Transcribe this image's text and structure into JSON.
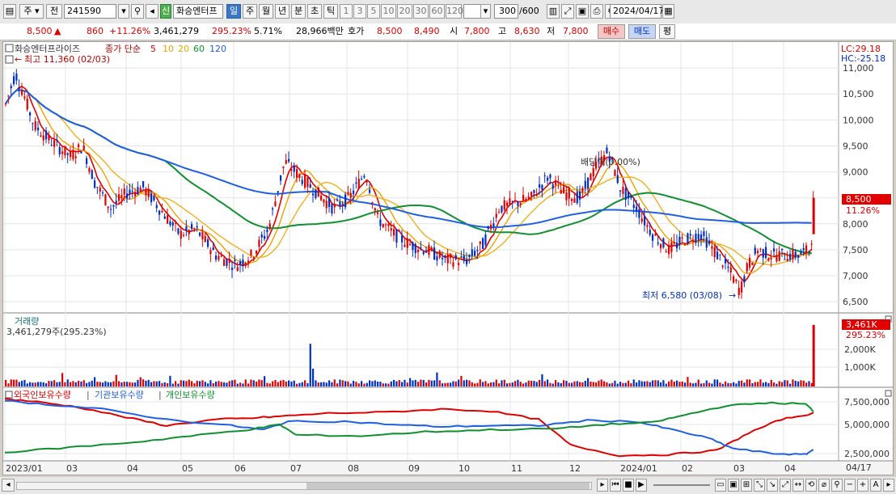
{
  "toolbar": {
    "market": "주",
    "type": "전",
    "code": "241590",
    "new_badge": "신",
    "stock_name": "화승엔터프",
    "periods": [
      "일",
      "주",
      "월",
      "년",
      "분",
      "초",
      "틱"
    ],
    "minute_options": [
      "1",
      "3",
      "5",
      "10",
      "20",
      "30",
      "60",
      "120"
    ],
    "count": "300",
    "count_total": "/600",
    "date": "2024/04/17"
  },
  "quote": {
    "price": "8,500",
    "change_arrow": "▲",
    "change": "860",
    "change_pct": "+11.26%",
    "volume": "3,461,279",
    "volume_pct": "295.23%",
    "turnover": "5.71%",
    "amount": "28,966백만",
    "hoga_label": "호가",
    "hoga_ask": "8,500",
    "hoga_bid": "8,490",
    "open_label": "시",
    "open": "7,800",
    "high_label": "고",
    "high": "8,630",
    "low_label": "저",
    "low": "7,800",
    "buy_label": "매수",
    "sell_label": "매도",
    "avg_label": "평"
  },
  "price_panel": {
    "title": "화승엔터프라이즈",
    "ma_label": "종가 단순",
    "ma_periods": [
      "5",
      "10",
      "20",
      "60",
      "120"
    ],
    "ma_colors": [
      "#e00000",
      "#f0a000",
      "#f0a000",
      "#109030",
      "#2060e0"
    ],
    "high_annotation": "최고 11,360 (02/03)",
    "low_annotation": "최저 6,580 (03/08)",
    "dividend_annotation": "배당락(0.00%)",
    "lc": "LC:29.18",
    "hc": "HC:-25.18",
    "current_price_tag": "8,500",
    "current_pct_tag": "11.26%",
    "y_ticks": [
      "11,000",
      "10,500",
      "10,000",
      "9,500",
      "9,000",
      "8,500",
      "8,000",
      "7,500",
      "7,000",
      "6,500"
    ],
    "y_values": [
      11000,
      10500,
      10000,
      9500,
      9000,
      8500,
      8000,
      7500,
      7000,
      6500
    ]
  },
  "volume_panel": {
    "title": "거래량",
    "value": "3,461,279주(295.23%)",
    "tag_value": "3,461K",
    "tag_pct": "295.23%",
    "y_ticks": [
      "2,000K",
      "1,000K"
    ]
  },
  "holding_panel": {
    "legend": [
      "외국인보유수량",
      "기관보유수량",
      "개인보유수량"
    ],
    "colors": [
      "#e00000",
      "#2060e0",
      "#109030"
    ],
    "y_ticks": [
      "7,500,000",
      "5,000,000",
      "2,500,000"
    ]
  },
  "x_axis": {
    "labels": [
      "2023/01",
      "03",
      "04",
      "05",
      "06",
      "07",
      "08",
      "09",
      "10",
      "11",
      "12",
      "2024/01",
      "02",
      "03",
      "04"
    ],
    "last_date": "04/17"
  },
  "chart_data": {
    "type": "candlestick",
    "ma_periods": [
      5,
      10,
      20,
      60,
      120
    ],
    "high": {
      "value": 11360,
      "date": "02/03"
    },
    "low": {
      "value": 6580,
      "date": "03/08"
    },
    "last": {
      "close": 8500,
      "open": 7800,
      "high": 8630,
      "low": 7800,
      "volume": 3461279
    }
  }
}
